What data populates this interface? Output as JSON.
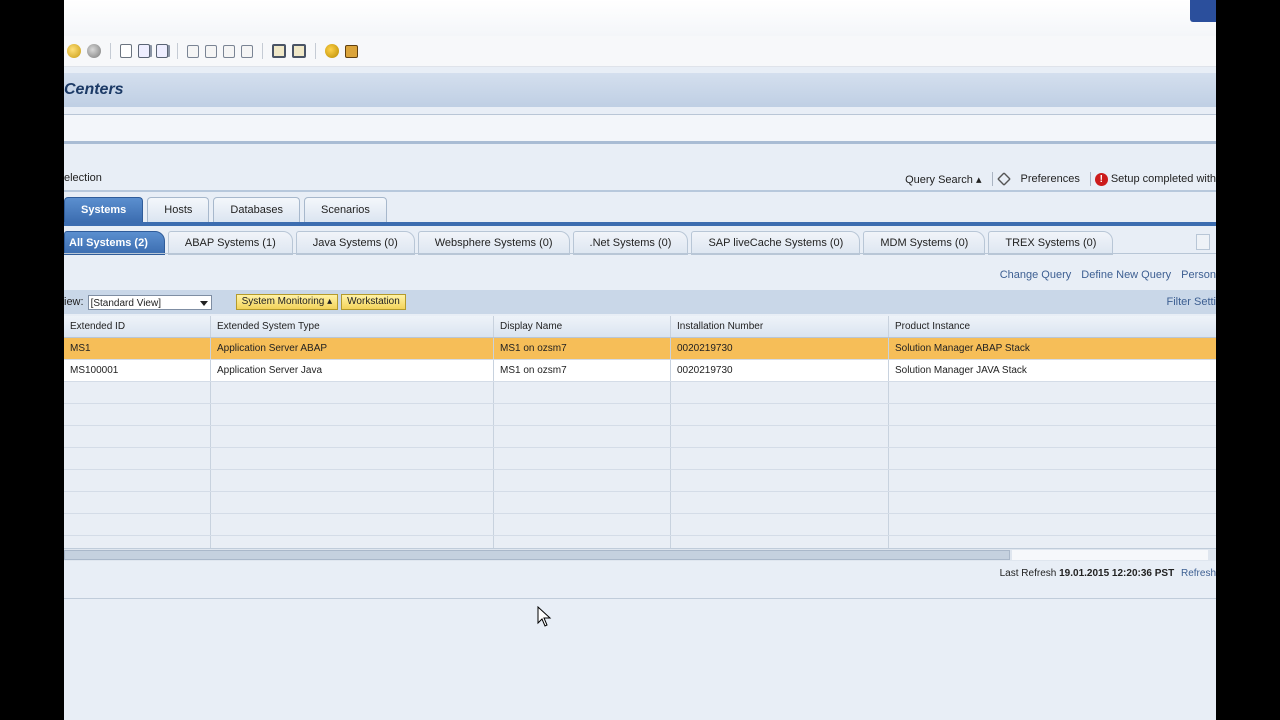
{
  "page": {
    "title": "Centers"
  },
  "selection": {
    "label": "election",
    "links": {
      "query_search": "Query Search ▴",
      "preferences": "Preferences",
      "setup_status": "Setup completed with"
    }
  },
  "main_tabs": [
    {
      "label": "Systems",
      "active": true
    },
    {
      "label": "Hosts"
    },
    {
      "label": "Databases"
    },
    {
      "label": "Scenarios"
    }
  ],
  "sub_tabs": [
    {
      "label": "All Systems (2)",
      "active": true
    },
    {
      "label": "ABAP Systems (1)"
    },
    {
      "label": "Java Systems (0)"
    },
    {
      "label": "Websphere Systems (0)"
    },
    {
      "label": ".Net Systems (0)"
    },
    {
      "label": "SAP liveCache Systems (0)"
    },
    {
      "label": "MDM Systems (0)"
    },
    {
      "label": "TREX Systems (0)"
    }
  ],
  "query_links": {
    "change_query": "Change Query",
    "define_new_query": "Define New Query",
    "personalize": "Person"
  },
  "viewbar": {
    "view_label": "iew:",
    "view_value": "[Standard View]",
    "system_monitoring": "System Monitoring ▴",
    "workstation": "Workstation",
    "filter_settings": "Filter Setti"
  },
  "table": {
    "columns": [
      "Extended ID",
      "Extended System Type",
      "Display Name",
      "Installation Number",
      "Product Instance"
    ],
    "rows": [
      [
        "MS1",
        "Application Server ABAP",
        "MS1 on ozsm7",
        "0020219730",
        "Solution Manager ABAP Stack"
      ],
      [
        "MS100001",
        "Application Server Java",
        "MS1 on ozsm7",
        "0020219730",
        "Solution Manager JAVA Stack"
      ]
    ]
  },
  "footer": {
    "last_refresh_label": "Last Refresh",
    "last_refresh_value": "19.01.2015 12:20:36 PST",
    "refresh_link": "Refresh"
  },
  "colors": {
    "accent": "#3c6db0",
    "selected_row": "#f6be58",
    "background": "#e8eef6"
  }
}
